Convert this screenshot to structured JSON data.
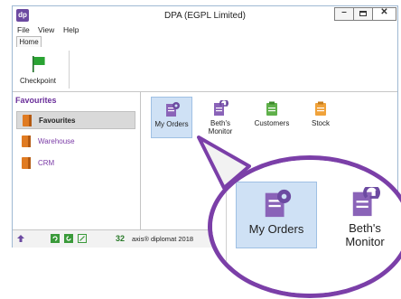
{
  "window": {
    "title": "DPA (EGPL Limited)",
    "app_icon_text": "dp"
  },
  "menu": [
    "File",
    "View",
    "Help"
  ],
  "ribbon_tabs": [
    "Home"
  ],
  "ribbon": {
    "checkpoint_label": "Checkpoint",
    "checkpoint_color": "#29a332"
  },
  "favourites": {
    "header": "Favourites",
    "items": [
      {
        "label": "Favourites",
        "selected": true
      },
      {
        "label": "Warehouse",
        "selected": false
      },
      {
        "label": "CRM",
        "selected": false
      }
    ]
  },
  "status_bar": {
    "count": "32",
    "brand": "axis® diplomat 2018"
  },
  "tiles": [
    {
      "label": "My Orders",
      "icon": "my-orders-icon",
      "selected": true
    },
    {
      "label": "Beth's\nMonitor",
      "icon": "beths-monitor-icon",
      "selected": false
    },
    {
      "label": "Customers",
      "icon": "customers-icon",
      "selected": false
    },
    {
      "label": "Stock",
      "icon": "stock-icon",
      "selected": false
    }
  ],
  "zoom": {
    "tiles": [
      {
        "label": "My Orders",
        "icon": "my-orders-icon",
        "selected": true
      },
      {
        "label": "Beth's\nMonitor",
        "icon": "beths-monitor-icon",
        "selected": false
      }
    ]
  },
  "colors": {
    "accent": "#7b3fa8",
    "selected_tile": "#cfe1f5",
    "orange": "#e07b22"
  }
}
